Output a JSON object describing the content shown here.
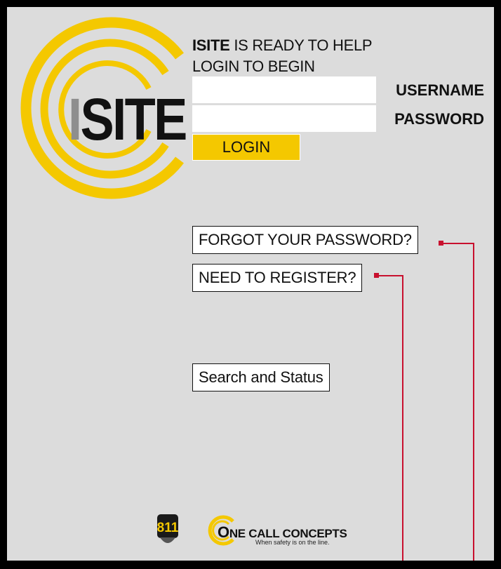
{
  "brand": {
    "logo_text_prefix": "I",
    "logo_text_rest": "SITE",
    "accent_color": "#f4c800"
  },
  "login": {
    "headline_brand": "ISITE",
    "headline_rest": " IS READY TO HELP",
    "subline": "LOGIN TO BEGIN",
    "username_label": "USERNAME",
    "username_value": "",
    "password_label": "PASSWORD",
    "password_value": "",
    "login_button": "LOGIN"
  },
  "links": {
    "forgot_password": "FORGOT YOUR PASSWORD?",
    "register": "NEED TO REGISTER?",
    "search_status": "Search and Status"
  },
  "footer": {
    "badge_811": "811",
    "company_initial": "O",
    "company_rest": "NE CALL CONCEPTS",
    "tagline": "When safety is on the line."
  },
  "annotation_color": "#c8102e"
}
